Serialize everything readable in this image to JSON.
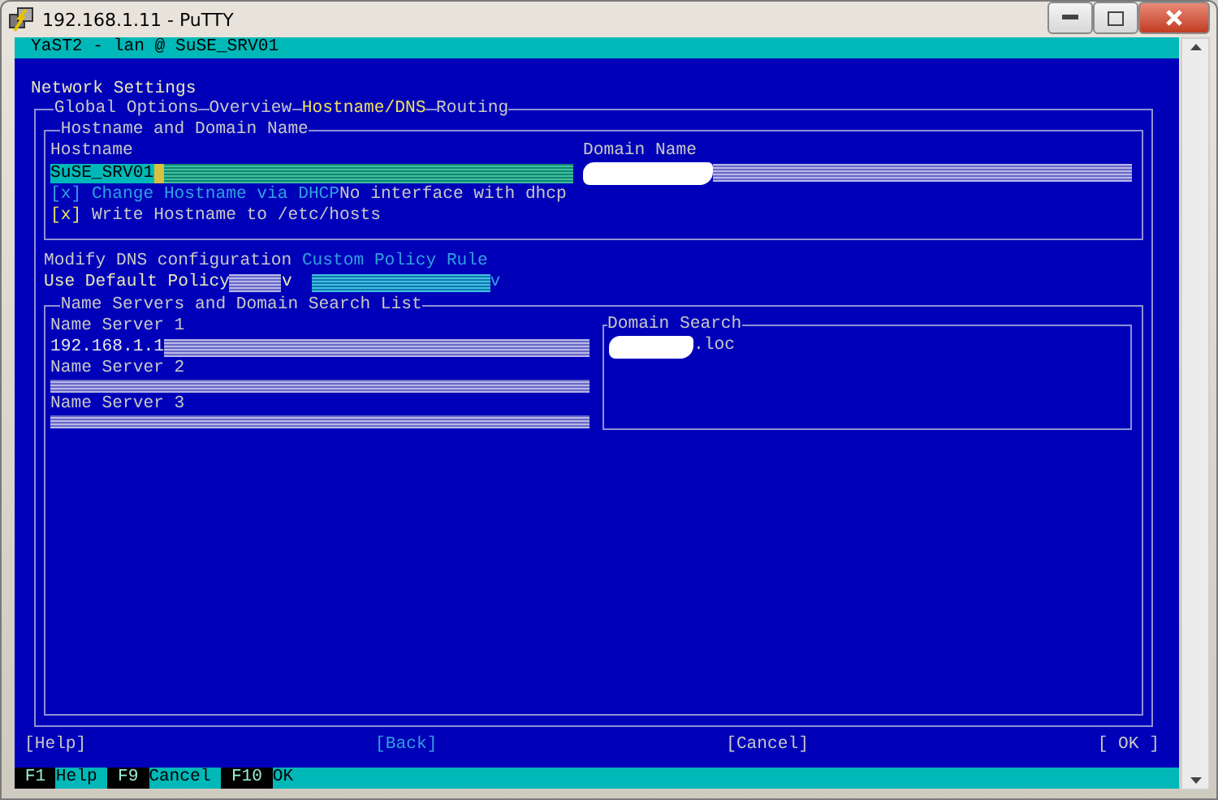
{
  "window": {
    "title": "192.168.1.11 - PuTTY"
  },
  "terminal_title": "YaST2 - lan @ SuSE_SRV01",
  "heading": "Network Settings",
  "tabs": [
    {
      "label": "Global Options",
      "selected": false
    },
    {
      "label": "Overview",
      "selected": false
    },
    {
      "label": "Hostname/DNS",
      "selected": true
    },
    {
      "label": "Routing",
      "selected": false
    }
  ],
  "hostname_section": {
    "title": "Hostname and Domain Name",
    "hostname": {
      "label": "Hostname",
      "value": "SuSE_SRV01",
      "focused": true
    },
    "domain_name": {
      "label": "Domain Name",
      "focused": false
    },
    "checkboxes": [
      {
        "mark": "[x]",
        "label": "Change Hostname via DHCP",
        "checked": true,
        "disabled": true,
        "note": "No interface with dhcp"
      },
      {
        "mark": "[x]",
        "label": "Write Hostname to /etc/hosts",
        "checked": true,
        "disabled": false
      }
    ]
  },
  "dns": {
    "label": "Modify DNS configuration",
    "policy": {
      "value": "Use Default Policy",
      "arrow": "v",
      "disabled": false
    },
    "custom_rule": {
      "label": "Custom Policy Rule",
      "arrow": "v",
      "disabled": true
    }
  },
  "name_servers": {
    "title": "Name Servers and Domain Search List",
    "servers": [
      {
        "label": "Name Server 1",
        "value": "192.168.1.1"
      },
      {
        "label": "Name Server 2"
      },
      {
        "label": "Name Server 3"
      }
    ],
    "domain_search": {
      "label": "Domain Search",
      "entries": [
        ".loc"
      ]
    }
  },
  "buttons": [
    {
      "label": "[Help]",
      "disabled": false
    },
    {
      "label": "[Back]",
      "disabled": true
    },
    {
      "label": "[Cancel]",
      "disabled": false
    },
    {
      "label": "[ OK ]",
      "disabled": false
    }
  ],
  "function_keys": [
    {
      "key": "F1",
      "label": "Help"
    },
    {
      "key": "F9",
      "label": "Cancel"
    },
    {
      "key": "F10",
      "label": "OK"
    }
  ]
}
